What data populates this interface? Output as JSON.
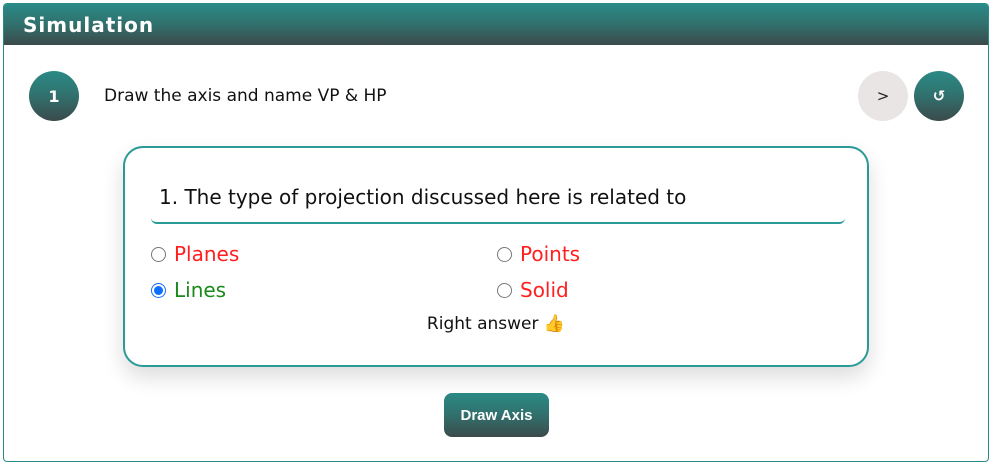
{
  "header": {
    "title": "Simulation"
  },
  "step": {
    "number": "1",
    "instruction": "Draw the axis and name VP & HP"
  },
  "nav": {
    "next_label": ">",
    "reset_label": "↺"
  },
  "quiz": {
    "question": "1. The type of projection discussed here is related to",
    "options": [
      {
        "label": "Planes",
        "checked": false,
        "color": "#ff1f1f"
      },
      {
        "label": "Points",
        "checked": false,
        "color": "#ff1f1f"
      },
      {
        "label": "Lines",
        "checked": true,
        "color": "#1a8a1a"
      },
      {
        "label": "Solid",
        "checked": false,
        "color": "#ff1f1f"
      }
    ],
    "feedback": "Right answer 👍"
  },
  "actions": {
    "draw_axis_label": "Draw Axis"
  },
  "colors": {
    "accent": "#2a8a86",
    "accent_dark": "#3b4a4b",
    "correct": "#1a8a1a",
    "incorrect": "#ff1f1f"
  }
}
